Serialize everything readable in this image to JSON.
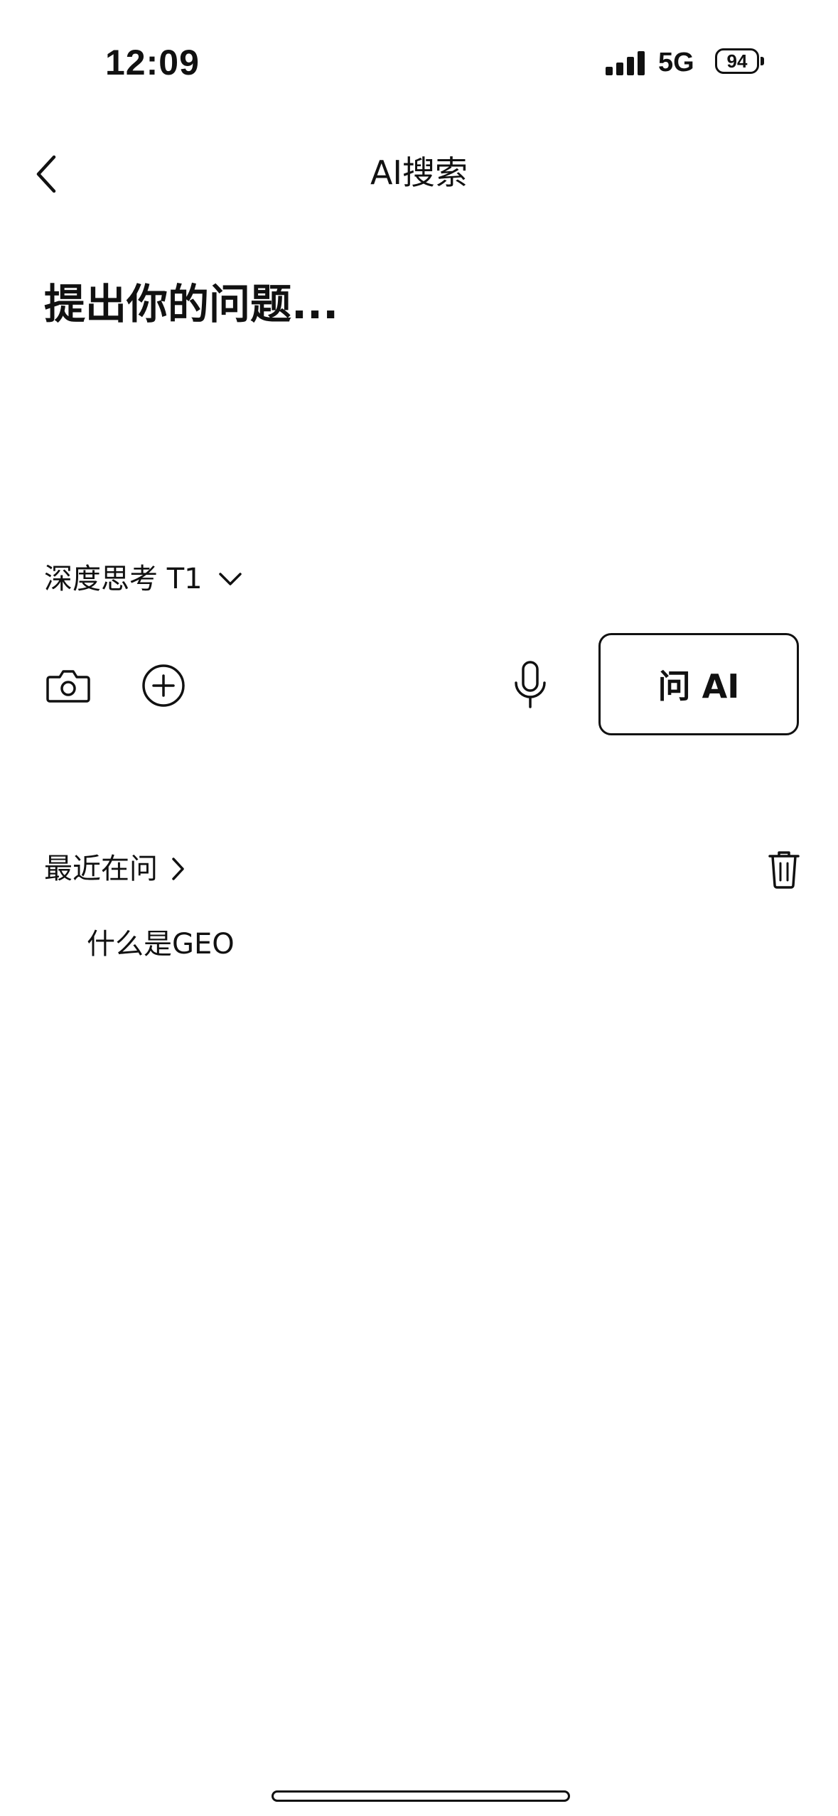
{
  "status_bar": {
    "time": "12:09",
    "network": "5G",
    "battery": "94",
    "signal_bars": 4
  },
  "nav": {
    "back_icon": "chevron-left-icon",
    "title": "AI搜索"
  },
  "question": {
    "placeholder": "提出你的问题...",
    "value": ""
  },
  "mode": {
    "label": "深度思考 T1",
    "icon": "chevron-down-icon"
  },
  "toolbar": {
    "camera_icon": "camera-icon",
    "add_icon": "plus-circle-icon",
    "mic_icon": "microphone-icon",
    "ask_label": "问 AI"
  },
  "recent": {
    "title": "最近在问",
    "chevron_icon": "chevron-right-icon",
    "trash_icon": "trash-icon",
    "items": [
      {
        "label": "什么是GEO"
      }
    ]
  },
  "colors": {
    "text": "#111111",
    "background": "#ffffff"
  }
}
